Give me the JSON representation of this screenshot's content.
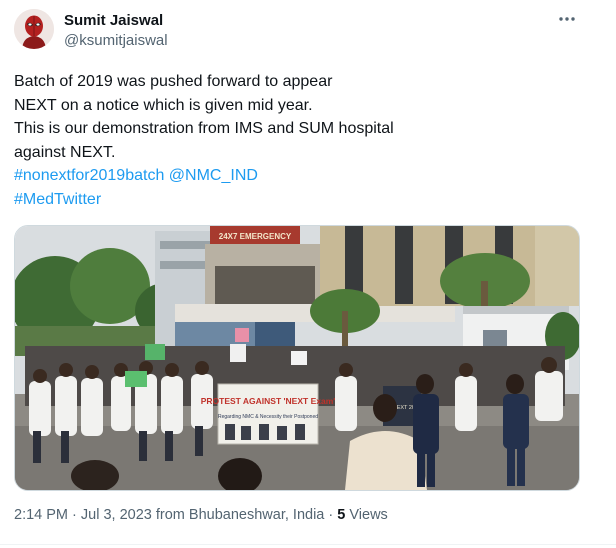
{
  "author": {
    "display_name": "Sumit Jaiswal",
    "handle": "@ksumitjaiswal",
    "avatar_icon": "deadpool-avatar-icon"
  },
  "more_icon": "more-options-icon",
  "tweet": {
    "lines": [
      "Batch of 2019 was pushed forward to appear",
      "NEXT on a notice which is given mid year.",
      "This is our demonstration from IMS and SUM hospital",
      "against NEXT."
    ],
    "hashtag_1": "#nonextfor2019batch",
    "mention": "@NMC_IND",
    "hashtag_2": "#MedTwitter"
  },
  "photo": {
    "banner_text": "PROTEST AGAINST 'NEXT Exam'",
    "banner_subtext": "Regarding NMC & Necessity their Postponed",
    "building_sign": "24X7 EMERGENCY",
    "right_sign": "NO NEXT 2019"
  },
  "meta": {
    "time": "2:14 PM",
    "separator": "·",
    "date": "Jul 3, 2023",
    "location": "from Bhubaneshwar, India",
    "views_count": "5",
    "views_label": "Views"
  },
  "colors": {
    "link": "#1d9bf0",
    "secondary_text": "#536471",
    "primary_text": "#0f1419"
  }
}
